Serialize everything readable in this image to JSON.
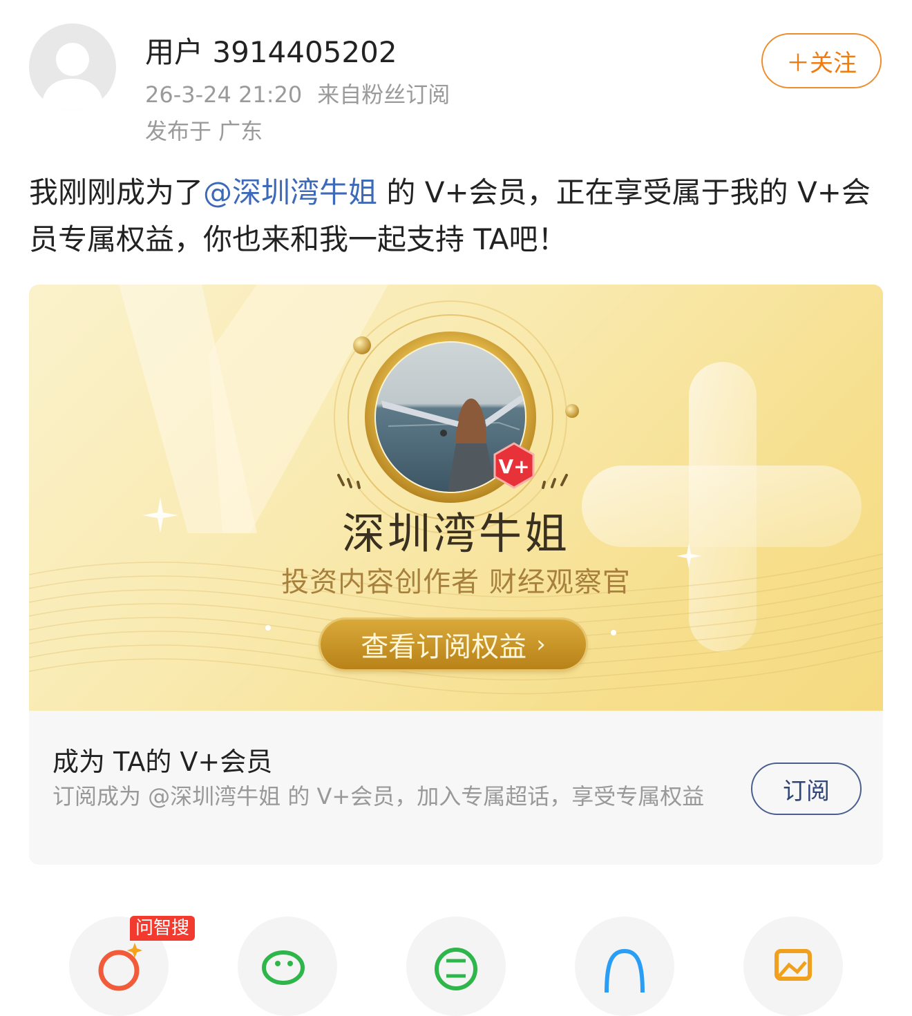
{
  "post": {
    "username": "用户 3914405202",
    "time": "26-3-24 21:20",
    "source": "来自粉丝订阅",
    "location": "发布于 广东",
    "follow_label": "＋关注",
    "text_prefix": "我刚刚成为了",
    "mention": "@深圳湾牛姐",
    "text_suffix": " 的 V+会员，正在享受属于我的 V+会员专属权益，你也来和我一起支持 TA吧！"
  },
  "card": {
    "banner_badge": "V+",
    "creator_name": "深圳湾牛姐",
    "creator_tags": "投资内容创作者 财经观察官",
    "view_benefits_label": "查看订阅权益",
    "chevron": "›",
    "footer_title": "成为 TA的 V+会员",
    "footer_desc": "订阅成为 @深圳湾牛姐 的 V+会员，加入专属超话，享受专属权益",
    "subscribe_label": "订阅"
  },
  "share_bar": {
    "badge": "问智搜",
    "items": [
      "ai-search-icon",
      "wechat-icon",
      "moments-icon",
      "qq-icon",
      "image-icon"
    ]
  },
  "colors": {
    "accent_orange": "#f07c10",
    "mention_blue": "#3d6ab8",
    "gold": "#c9952a",
    "badge_red": "#f23a2f"
  }
}
